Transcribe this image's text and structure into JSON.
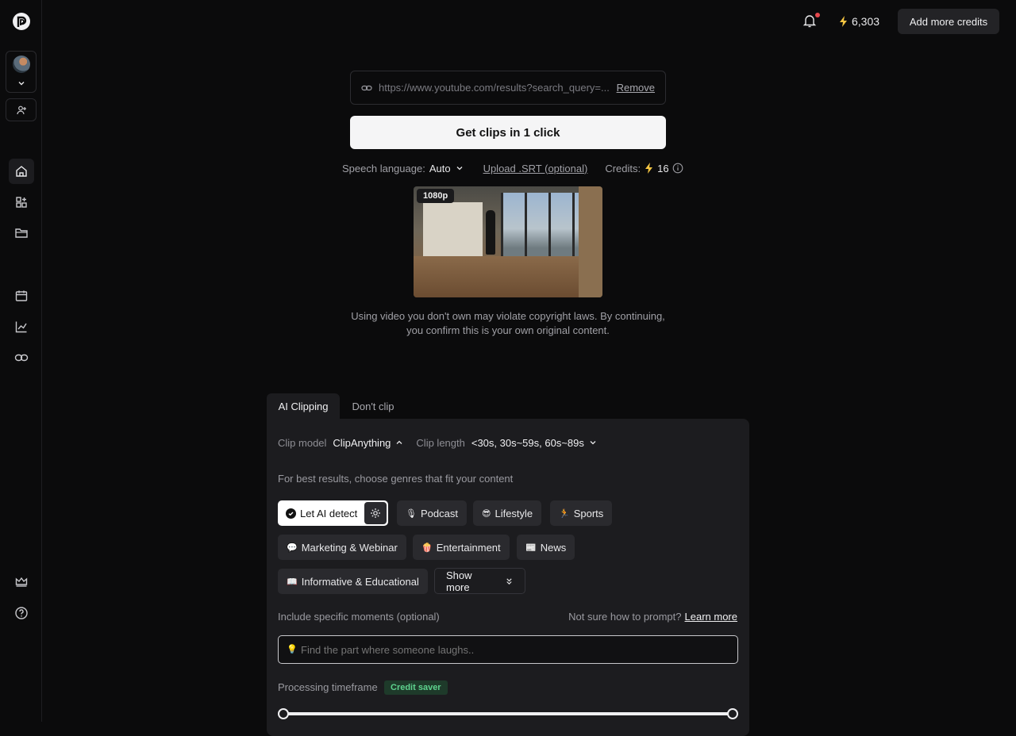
{
  "topbar": {
    "credits": "6,303",
    "add_credits_label": "Add more credits"
  },
  "url": {
    "value": "https://www.youtube.com/results?search_query=...",
    "remove_label": "Remove"
  },
  "primary": {
    "get_clips_label": "Get clips in 1 click"
  },
  "settings_row": {
    "speech_language_label": "Speech language:",
    "speech_language_value": "Auto",
    "upload_srt_label": "Upload .SRT (optional)",
    "credits_label": "Credits:",
    "credits_value": "16"
  },
  "video": {
    "resolution_badge": "1080p"
  },
  "disclaimer": "Using video you don't own may violate copyright laws. By continuing, you confirm this is your own original content.",
  "tabs": [
    {
      "label": "AI Clipping",
      "active": true
    },
    {
      "label": "Don't clip",
      "active": false
    }
  ],
  "clip": {
    "model_label": "Clip model",
    "model_value": "ClipAnything",
    "length_label": "Clip length",
    "length_value": "<30s, 30s~59s, 60s~89s"
  },
  "genres": {
    "hint": "For best results, choose genres that fit your content",
    "ai_detect_label": "Let AI detect",
    "items": [
      {
        "emoji": "🎙",
        "label": "Podcast"
      },
      {
        "emoji": "😎",
        "label": "Lifestyle"
      },
      {
        "emoji": "🏃",
        "label": "Sports"
      },
      {
        "emoji": "💬",
        "label": "Marketing & Webinar"
      },
      {
        "emoji": "🍿",
        "label": "Entertainment"
      },
      {
        "emoji": "📰",
        "label": "News"
      },
      {
        "emoji": "📖",
        "label": "Informative & Educational"
      }
    ],
    "show_more_label": "Show more"
  },
  "moments": {
    "label": "Include specific moments (optional)",
    "help_text": "Not sure how to prompt?",
    "learn_more": "Learn more",
    "placeholder": "Find the part where someone laughs..",
    "bulb": "💡"
  },
  "timeframe": {
    "label": "Processing timeframe",
    "badge": "Credit saver",
    "range_fraction": [
      0,
      1
    ]
  },
  "colors": {
    "accent_bolt": "#f5c542",
    "notification_dot": "#e5484d",
    "credit_saver_text": "#5ed28e"
  }
}
